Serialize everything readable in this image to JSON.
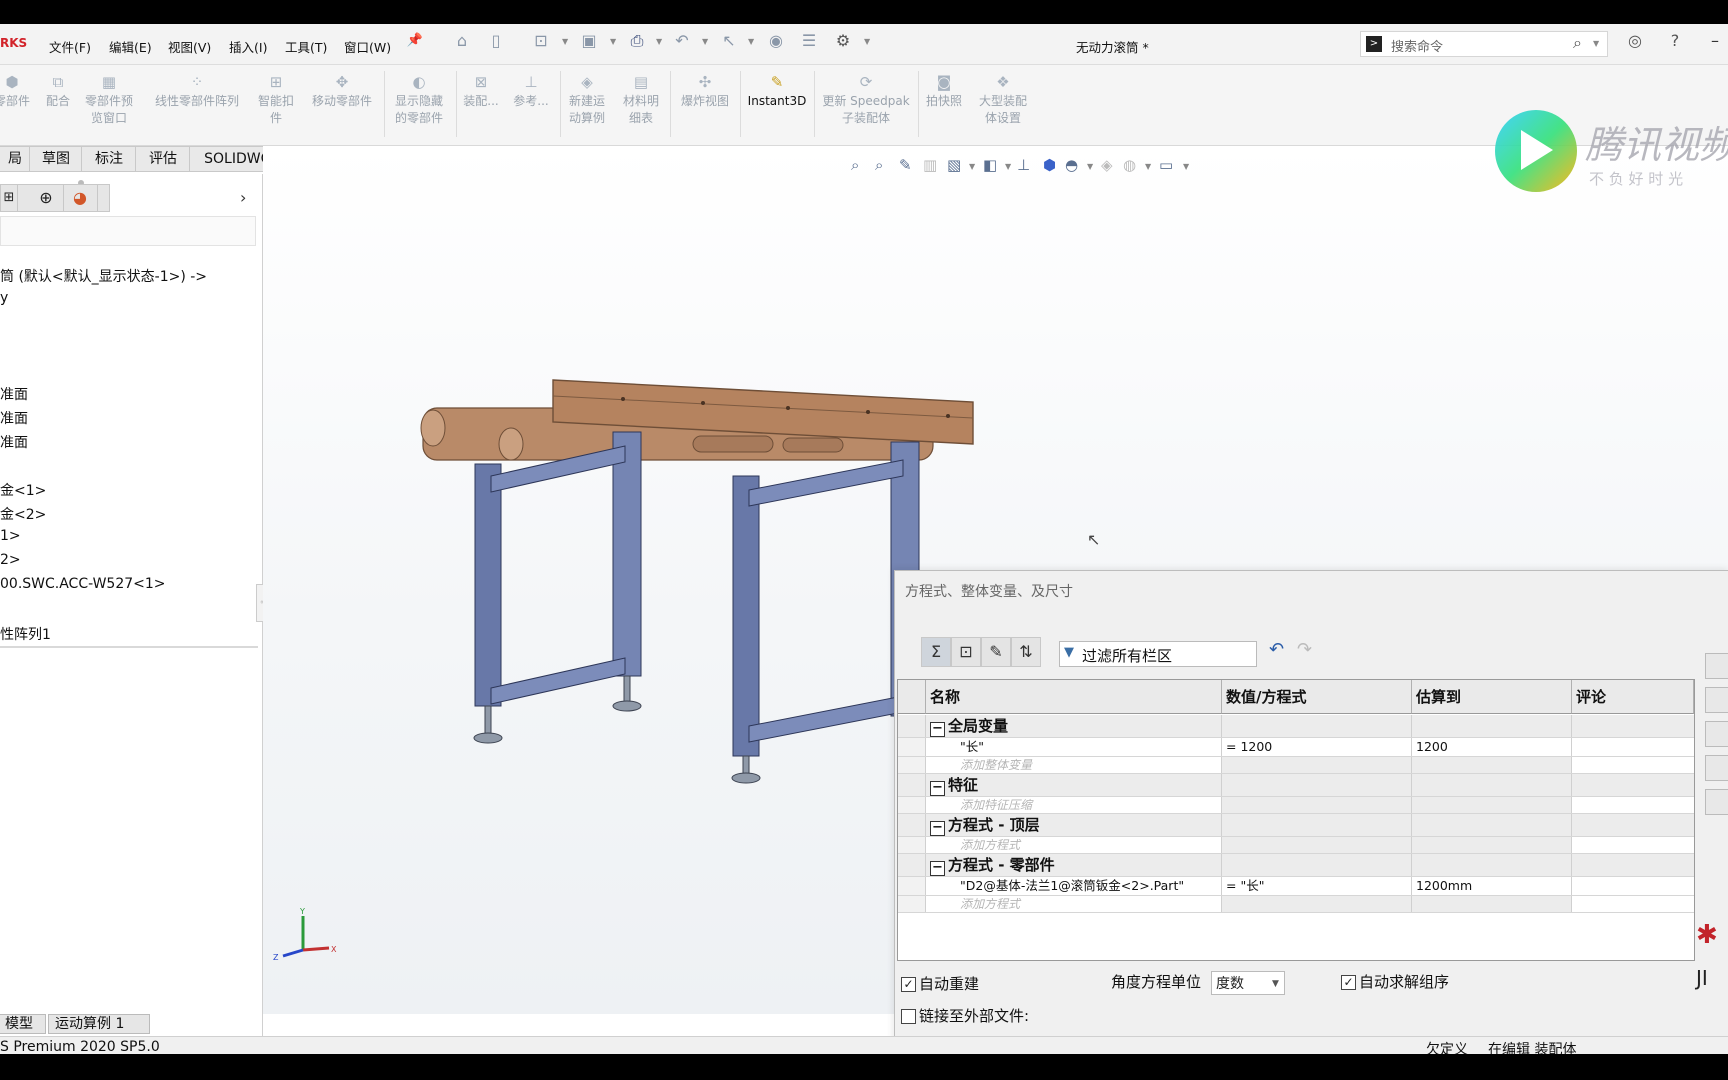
{
  "app": {
    "brand": "RKS",
    "doc_title": "无动力滚筒 *"
  },
  "menu": [
    "文件(F)",
    "编辑(E)",
    "视图(V)",
    "插入(I)",
    "工具(T)",
    "窗口(W)"
  ],
  "search": {
    "placeholder": "搜索命令"
  },
  "commands": [
    {
      "label": "零部件"
    },
    {
      "label": "配合"
    },
    {
      "label": "零部件预\n览窗口"
    },
    {
      "label": "线性零部件阵列"
    },
    {
      "label": "智能扣\n件"
    },
    {
      "label": "移动零部件"
    },
    {
      "label": "显示隐藏\n的零部件"
    },
    {
      "label": "装配..."
    },
    {
      "label": "参考..."
    },
    {
      "label": "新建运\n动算例"
    },
    {
      "label": "材料明\n细表"
    },
    {
      "label": "爆炸视图"
    },
    {
      "label": "Instant3D"
    },
    {
      "label": "更新 Speedpak\n子装配体"
    },
    {
      "label": "拍快照"
    },
    {
      "label": "大型装配\n体设置"
    }
  ],
  "tabs": [
    "局",
    "草图",
    "标注",
    "评估",
    "SOLIDWORKS 插件"
  ],
  "tree": [
    "筒 (默认<默认_显示状态-1>) ->",
    "y",
    "准面",
    "准面",
    "准面",
    "金<1>",
    "金<2>",
    "1>",
    "2>",
    "00.SWC.ACC-W527<1>",
    "性阵列1"
  ],
  "bottom_tabs": [
    "模型",
    "运动算例 1"
  ],
  "status": {
    "version": "S Premium 2020 SP5.0",
    "defined": "欠定义",
    "editing": "在编辑 装配体"
  },
  "watermark": {
    "text": "腾讯视频",
    "slogan": "不 负 好 时 光",
    "side": "JI"
  },
  "equations": {
    "title": "方程式、整体变量、及尺寸",
    "filter": "过滤所有栏区",
    "columns": [
      "名称",
      "数值/方程式",
      "估算到",
      "评论"
    ],
    "sections": [
      {
        "name": "全局变量",
        "rows": [
          {
            "name": "\"长\"",
            "value": "= 1200",
            "eval": "1200"
          }
        ],
        "add_hint": "添加整体变量"
      },
      {
        "name": "特征",
        "rows": [],
        "add_hint": "添加特征压缩"
      },
      {
        "name": "方程式 - 顶层",
        "rows": [],
        "add_hint": "添加方程式"
      },
      {
        "name": "方程式 - 零部件",
        "rows": [
          {
            "name": "\"D2@基体-法兰1@滚筒钣金<2>.Part\"",
            "value": "= \"长\"",
            "eval": "1200mm"
          }
        ],
        "add_hint": "添加方程式"
      }
    ],
    "auto_rebuild": "自动重建",
    "auto_rebuild_checked": true,
    "angle_unit_label": "角度方程单位",
    "angle_unit": "度数",
    "auto_solve": "自动求解组序",
    "auto_solve_checked": true,
    "link_external": "链接至外部文件:",
    "link_external_checked": false
  },
  "colors": {
    "rollers": "#b98a68",
    "frame": "#6878a8",
    "brand": "#d2232a"
  }
}
